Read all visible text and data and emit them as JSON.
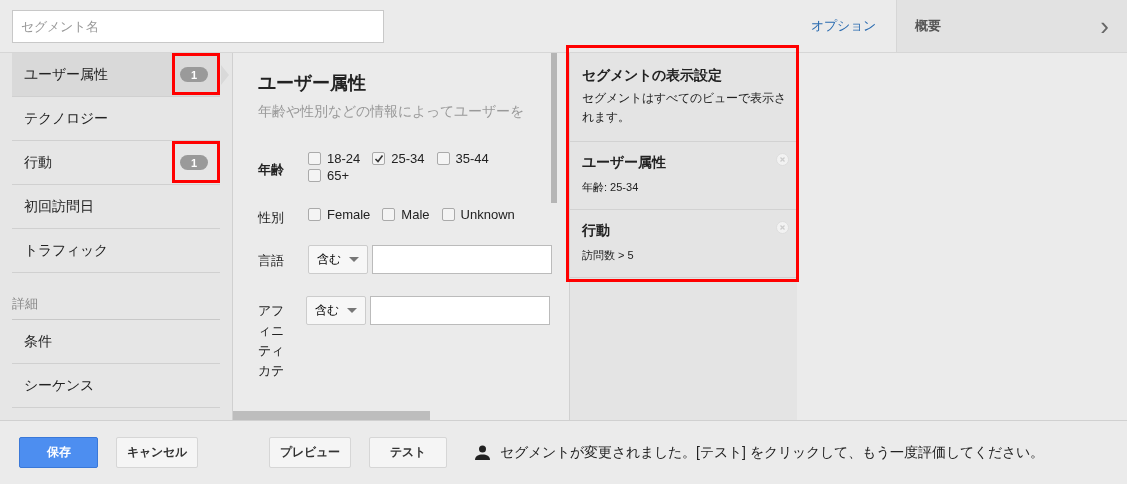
{
  "header": {
    "segment_name": {
      "placeholder": "セグメント名"
    },
    "options_link": "オプション",
    "summary_tab": "概要",
    "expand": "›"
  },
  "nav": {
    "items": [
      {
        "label": "ユーザー属性",
        "selected": true,
        "count": "1",
        "highlighted": true
      },
      {
        "label": "テクノロジー",
        "selected": false,
        "highlighted": false
      },
      {
        "label": "行動",
        "selected": false,
        "count": "1",
        "highlighted": true
      },
      {
        "label": "初回訪問日",
        "selected": false,
        "highlighted": false
      },
      {
        "label": "トラフィック",
        "selected": false,
        "highlighted": false
      }
    ],
    "advanced_heading": "詳細",
    "advanced_items": [
      {
        "label": "条件",
        "selected": false
      },
      {
        "label": "シーケンス",
        "selected": false
      }
    ]
  },
  "form": {
    "title": "ユーザー属性",
    "description": "年齢や性別などの情報によってユーザーを",
    "age": {
      "label": "年齢",
      "options": [
        {
          "label": "18-24",
          "checked": false
        },
        {
          "label": "25-34",
          "checked": true
        },
        {
          "label": "35-44",
          "checked": false
        },
        {
          "label": "65+",
          "checked": false
        }
      ]
    },
    "gender": {
      "label": "性別",
      "options": [
        {
          "label": "Female",
          "checked": false
        },
        {
          "label": "Male",
          "checked": false
        },
        {
          "label": "Unknown",
          "checked": false
        }
      ]
    },
    "filters": [
      {
        "label": "言語",
        "operator": "含む"
      },
      {
        "label": "アフィニティカテ",
        "operator": "含む"
      }
    ]
  },
  "summary": {
    "highlighted": true,
    "title": "セグメントの表示設定",
    "note": "セグメントはすべてのビューで表示されます。",
    "conditions": [
      {
        "title": "ユーザー属性",
        "detail": "年齢: 25-34"
      },
      {
        "title": "行動",
        "detail": "訪問数 > 5"
      }
    ]
  },
  "footer": {
    "buttons": [
      {
        "label": "保存",
        "kind": "primary"
      },
      {
        "label": "キャンセル",
        "kind": "normal"
      },
      {
        "label": "プレビュー",
        "kind": "normal"
      },
      {
        "label": "テスト",
        "kind": "normal"
      }
    ],
    "message": "セグメントが変更されました。[テスト] をクリックして、もう一度評価してください。"
  }
}
